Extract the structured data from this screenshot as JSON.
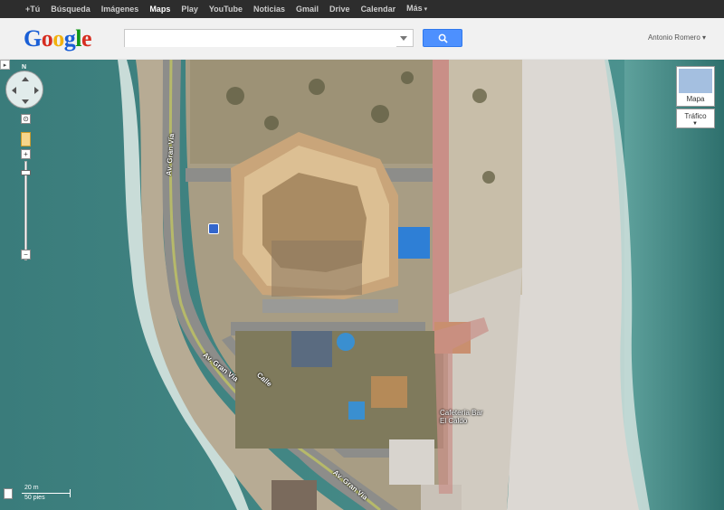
{
  "topnav": {
    "items": [
      {
        "label": "+Tú"
      },
      {
        "label": "Búsqueda"
      },
      {
        "label": "Imágenes"
      },
      {
        "label": "Maps",
        "active": true
      },
      {
        "label": "Play"
      },
      {
        "label": "YouTube"
      },
      {
        "label": "Noticias"
      },
      {
        "label": "Gmail"
      },
      {
        "label": "Drive"
      },
      {
        "label": "Calendar"
      },
      {
        "label": "Más"
      }
    ]
  },
  "header": {
    "logo": {
      "g1": "G",
      "o1": "o",
      "o2": "o",
      "g2": "g",
      "l": "l",
      "e": "e"
    },
    "search": {
      "value": "",
      "placeholder": ""
    },
    "user_name": "Antonio Romero ▾"
  },
  "map": {
    "controls": {
      "side_tab": "▸",
      "compass_label": "N",
      "zoom_in": "+",
      "zoom_out": "−",
      "zoom_level_fraction": 0.08
    },
    "layers": {
      "map_label": "Mapa",
      "traffic_label": "Tráfico",
      "traffic_caret": "▼"
    },
    "scale": {
      "metric": "20 m",
      "imperial": "50 pies"
    },
    "labels": {
      "road_gran_via_1": "Av. Gran Vía",
      "road_gran_via_2": "Av. Gran Vía",
      "road_gran_via_3": "Av. Gran Vía",
      "calle": "Calle",
      "poi_cafe_line1": "Cafetería Bar",
      "poi_cafe_line2": "El Caldo"
    }
  },
  "colors": {
    "sea": "#2f6f6c",
    "sand": "#d8d2c9",
    "road": "#8e8e8e",
    "accent_blue": "#4d90fe",
    "topbar": "#2d2d2d"
  }
}
